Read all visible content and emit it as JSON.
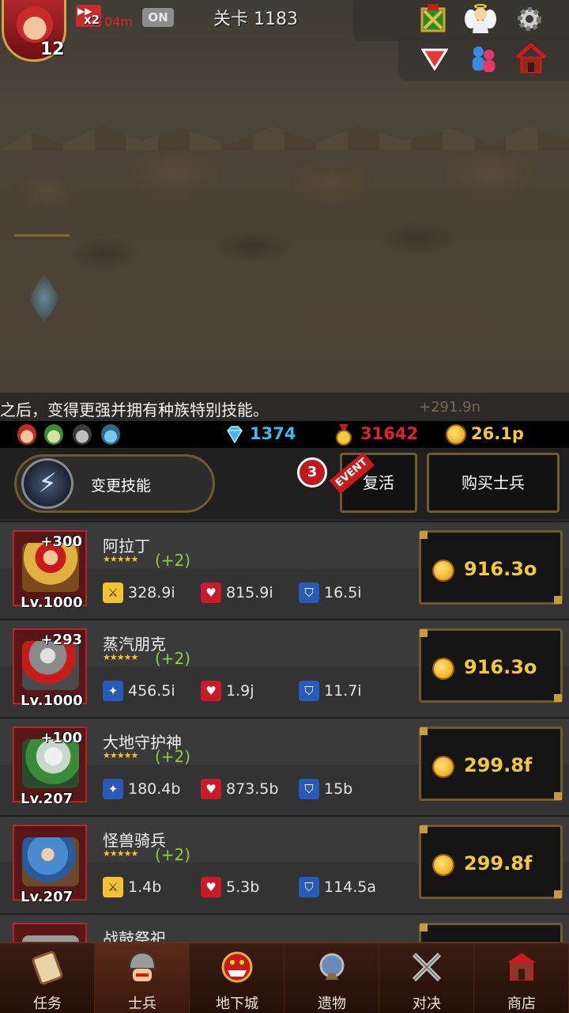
{
  "status_bar": {
    "player_level": "12",
    "speed_multiplier": "x2",
    "speed_time": "04m",
    "speed_toggle": "ON",
    "stage": "关卡 1183"
  },
  "top_right_icons": [
    "shield-crest-icon",
    "angel-icon",
    "gear-icon",
    "triangle-down-icon",
    "multiplayer-icon",
    "house-icon"
  ],
  "notice_text": "之后，变得更强并拥有种族特别技能。",
  "floating_damage": "+291.9n",
  "currency": {
    "gems": "1374",
    "medals": "31642",
    "gold": "26.1p"
  },
  "actions": {
    "change_skill_label": "变更技能",
    "badge_count": "3",
    "event_ribbon": "EVENT",
    "revive_label": "复活",
    "buy_soldier_label": "购买士兵"
  },
  "soldiers": [
    {
      "name": "阿拉丁",
      "bonus": "+300",
      "level": "Lv.1000",
      "stars": "★★★★★",
      "plus": "(+2)",
      "atk_icon": "sword-icon",
      "attack": "328.9i",
      "hp": "815.9i",
      "defense": "16.5i",
      "price": "916.3o"
    },
    {
      "name": "蒸汽朋克",
      "bonus": "+293",
      "level": "Lv.1000",
      "stars": "★★★★★",
      "plus": "(+2)",
      "atk_icon": "magic-wand-icon",
      "attack": "456.5i",
      "hp": "1.9j",
      "defense": "11.7i",
      "price": "916.3o"
    },
    {
      "name": "大地守护神",
      "bonus": "+100",
      "level": "Lv.207",
      "stars": "★★★★★",
      "plus": "(+2)",
      "atk_icon": "magic-wand-icon",
      "attack": "180.4b",
      "hp": "873.5b",
      "defense": "15b",
      "price": "299.8f"
    },
    {
      "name": "怪兽骑兵",
      "bonus": "",
      "level": "Lv.207",
      "stars": "★★★★★",
      "plus": "(+2)",
      "atk_icon": "sword-icon",
      "attack": "1.4b",
      "hp": "5.3b",
      "defense": "114.5a",
      "price": "299.8f"
    },
    {
      "name": "战鼓祭祀",
      "bonus": "",
      "level": "",
      "stars": "",
      "plus": "",
      "atk_icon": "",
      "attack": "",
      "hp": "",
      "defense": "",
      "price": ""
    }
  ],
  "nav": [
    {
      "label": "任务",
      "icon": "scroll-icon",
      "active": false
    },
    {
      "label": "士兵",
      "icon": "helmet-icon",
      "active": true
    },
    {
      "label": "地下城",
      "icon": "monster-icon",
      "active": false
    },
    {
      "label": "遗物",
      "icon": "orb-icon",
      "active": false
    },
    {
      "label": "对决",
      "icon": "crossed-swords-icon",
      "active": false
    },
    {
      "label": "商店",
      "icon": "shop-icon",
      "active": false
    }
  ],
  "colors": {
    "gold_text": "#f3c83a",
    "medal_red": "#e2222a",
    "gem_blue": "#42b8f0",
    "plus_green": "#8ccf3a",
    "frame_gold": "#6e5a2c"
  }
}
